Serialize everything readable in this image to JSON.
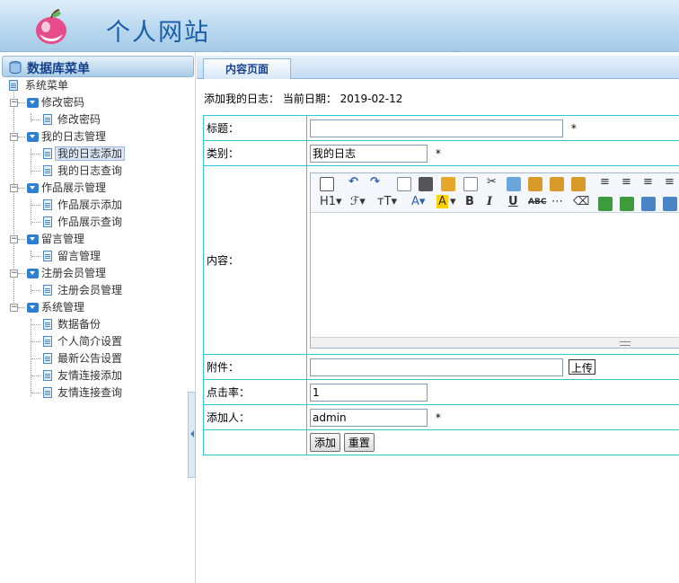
{
  "header": {
    "title": "个人网站",
    "logo_icon": "apple-logo-icon"
  },
  "sidebar": {
    "title": "数据库菜单",
    "tree": [
      {
        "label": "系统菜单",
        "type": "root"
      },
      {
        "label": "修改密码",
        "type": "group"
      },
      {
        "label": "修改密码",
        "type": "leaf"
      },
      {
        "label": "我的日志管理",
        "type": "group"
      },
      {
        "label": "我的日志添加",
        "type": "leaf",
        "selected": true
      },
      {
        "label": "我的日志查询",
        "type": "leaf"
      },
      {
        "label": "作品展示管理",
        "type": "group"
      },
      {
        "label": "作品展示添加",
        "type": "leaf"
      },
      {
        "label": "作品展示查询",
        "type": "leaf"
      },
      {
        "label": "留言管理",
        "type": "group"
      },
      {
        "label": "留言管理",
        "type": "leaf"
      },
      {
        "label": "注册会员管理",
        "type": "group"
      },
      {
        "label": "注册会员管理",
        "type": "leaf"
      },
      {
        "label": "系统管理",
        "type": "group"
      },
      {
        "label": "数据备份",
        "type": "leaf"
      },
      {
        "label": "个人简介设置",
        "type": "leaf"
      },
      {
        "label": "最新公告设置",
        "type": "leaf"
      },
      {
        "label": "友情连接添加",
        "type": "leaf"
      },
      {
        "label": "友情连接查询",
        "type": "leaf"
      }
    ]
  },
  "main": {
    "tab": "内容页面",
    "subtitle": "添加我的日志： 当前日期： 2019-02-12",
    "form": {
      "title_label": "标题：",
      "title_value": "",
      "category_label": "类别：",
      "category_value": "我的日志",
      "content_label": "内容：",
      "attach_label": "附件：",
      "upload_button": "上传",
      "hits_label": "点击率：",
      "hits_value": "1",
      "author_label": "添加人：",
      "author_value": "admin",
      "required_mark": "*",
      "submit_button": "添加",
      "reset_button": "重置"
    },
    "editor": {
      "heading_label": "H1",
      "font_label": "ℱ",
      "size_label": "тT",
      "color_label": "A",
      "bold_label": "B",
      "italic_label": "I",
      "underline_label": "U",
      "strike_label": "ABC"
    }
  }
}
